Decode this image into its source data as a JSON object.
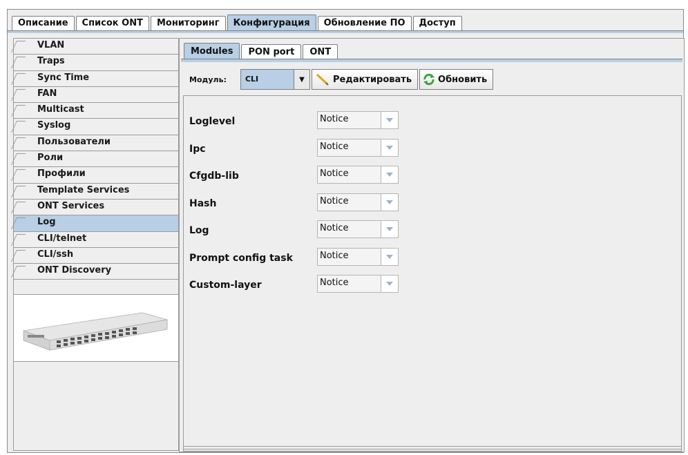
{
  "top_tabs": [
    "Описание",
    "Список ONT",
    "Мониторинг",
    "Конфигурация",
    "Обновление ПО",
    "Доступ"
  ],
  "active_top_tab": "Конфигурация",
  "sidebar": {
    "items": [
      "VLAN",
      "Traps",
      "Sync Time",
      "FAN",
      "Multicast",
      "Syslog",
      "Пользователи",
      "Роли",
      "Профили",
      "Template Services",
      "ONT Services",
      "Log",
      "CLI/telnet",
      "CLI/ssh",
      "ONT Discovery"
    ],
    "active": "Log"
  },
  "sub_tabs": [
    "Modules",
    "PON port",
    "ONT"
  ],
  "active_sub_tab": "Modules",
  "toolbar": {
    "module_label": "Модуль:",
    "module_value": "CLI",
    "edit_label": "Редактировать",
    "refresh_label": "Обновить"
  },
  "settings": [
    {
      "label": "Loglevel",
      "value": "Notice"
    },
    {
      "label": "Ipc",
      "value": "Notice"
    },
    {
      "label": "Cfgdb-lib",
      "value": "Notice"
    },
    {
      "label": "Hash",
      "value": "Notice"
    },
    {
      "label": "Log",
      "value": "Notice"
    },
    {
      "label": "Prompt config task",
      "value": "Notice"
    },
    {
      "label": "Custom-layer",
      "value": "Notice"
    }
  ],
  "colors": {
    "accent": "#b8cfe5",
    "background": "#eeeeee",
    "refresh_icon": "#3aa63a",
    "pencil_icon": "#e2a21c"
  }
}
